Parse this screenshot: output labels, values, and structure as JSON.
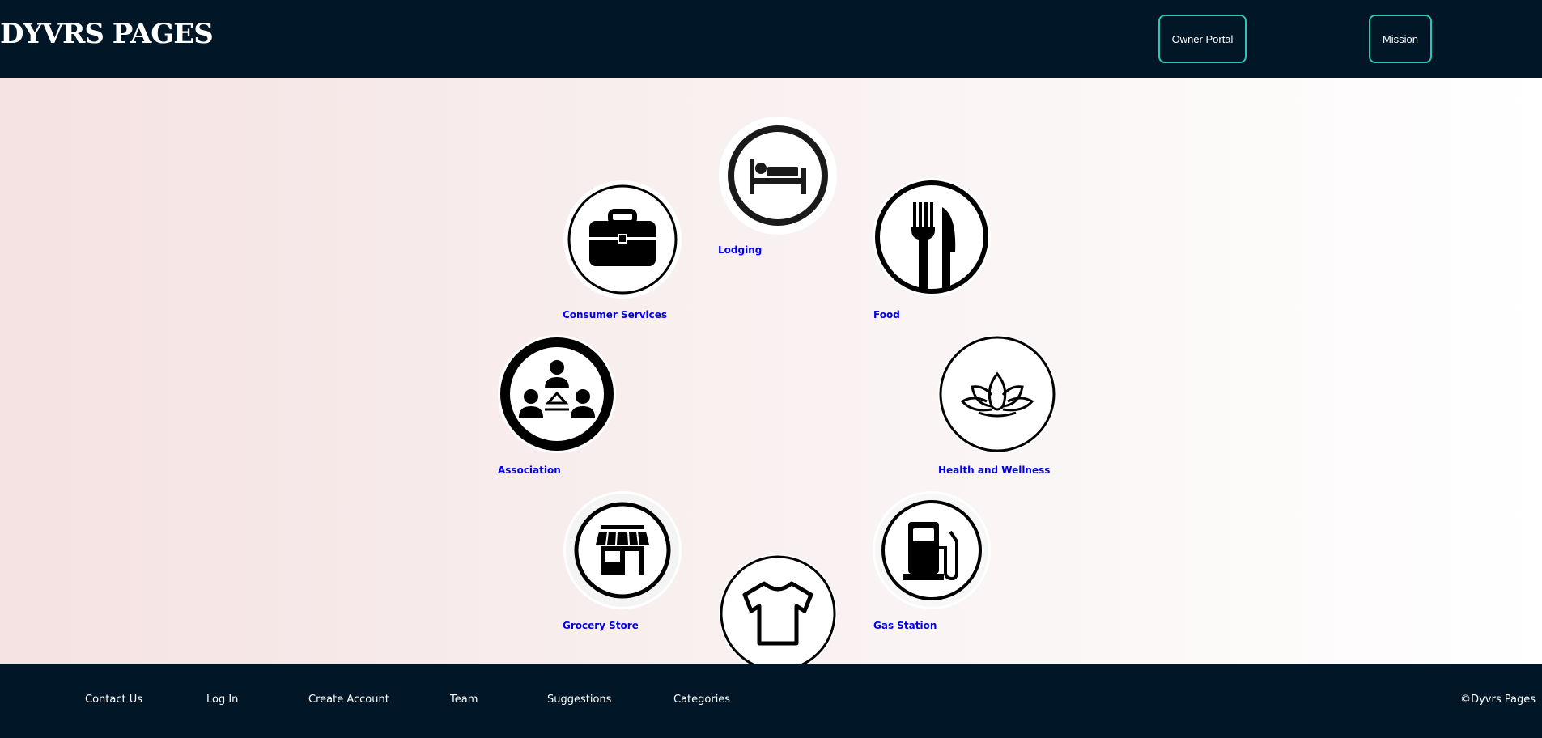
{
  "header": {
    "logo": "DYVRS PAGES",
    "buttons": {
      "owner_portal": "Owner Portal",
      "mission": "Mission"
    }
  },
  "categories": [
    {
      "label": "Lodging",
      "icon": "bed-icon"
    },
    {
      "label": "Consumer Services",
      "icon": "briefcase-icon"
    },
    {
      "label": "Food",
      "icon": "fork-knife-icon"
    },
    {
      "label": "Association",
      "icon": "people-network-icon"
    },
    {
      "label": "Health and Wellness",
      "icon": "lotus-icon"
    },
    {
      "label": "Grocery Store",
      "icon": "storefront-icon"
    },
    {
      "label": "Gas Station",
      "icon": "fuel-pump-icon"
    },
    {
      "label": "",
      "icon": "tshirt-icon"
    }
  ],
  "footer": {
    "links": [
      "Contact Us",
      "Log In",
      "Create Account",
      "Team",
      "Suggestions",
      "Categories"
    ],
    "copyright": "©Dyvrs Pages"
  },
  "colors": {
    "header_bg": "#011627",
    "button_border": "#2ec4b6",
    "link": "#0000ee"
  }
}
